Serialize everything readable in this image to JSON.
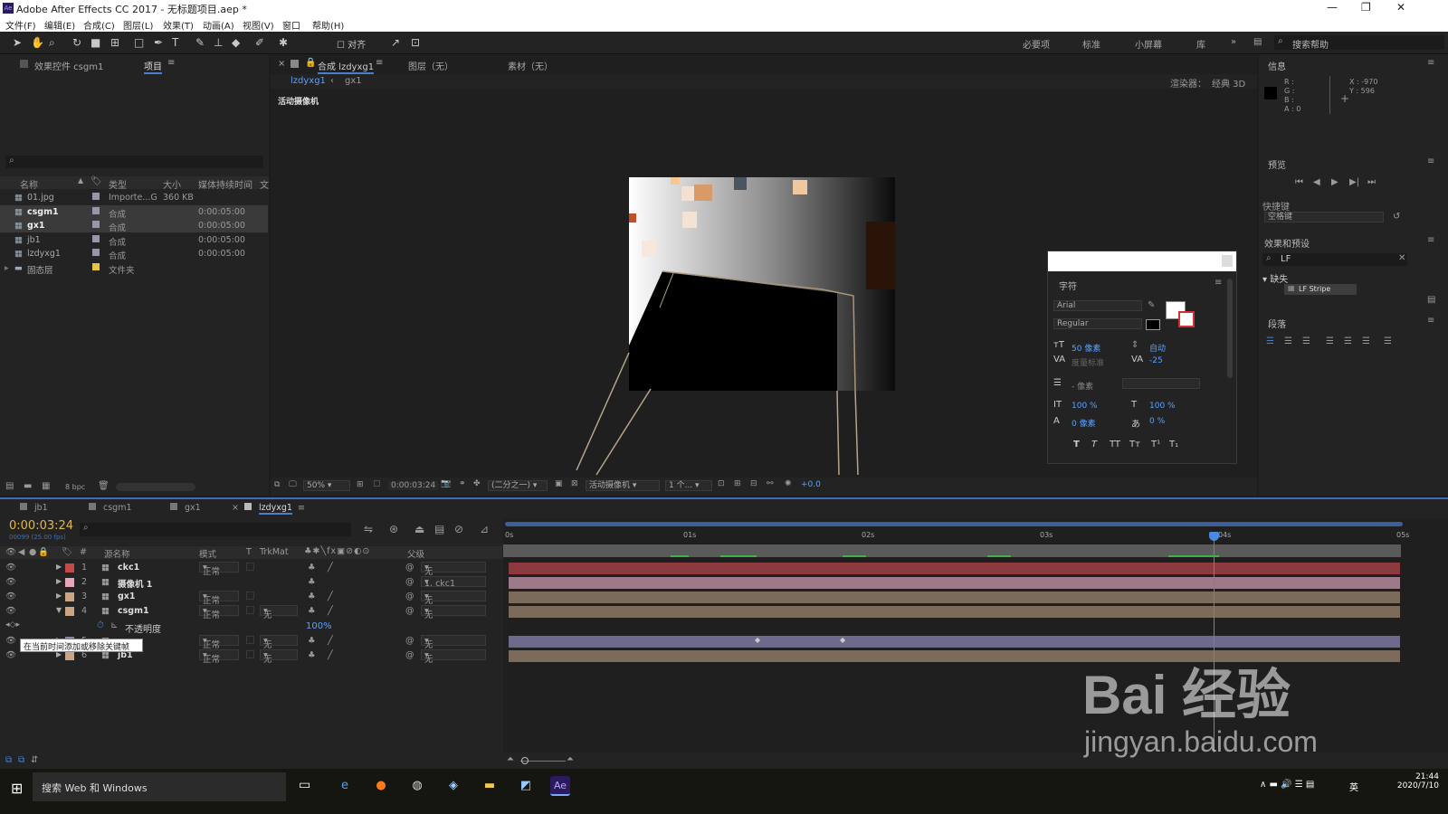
{
  "window": {
    "title": "Adobe After Effects CC 2017 - 无标题项目.aep *",
    "logo": "Ae"
  },
  "menu": [
    "文件(F)",
    "编辑(E)",
    "合成(C)",
    "图层(L)",
    "效果(T)",
    "动画(A)",
    "视图(V)",
    "窗口",
    "帮助(H)"
  ],
  "toolbar": {
    "snap_label": "对齐",
    "workspaces": [
      "必要项",
      "标准",
      "小屏幕",
      "库"
    ],
    "search_placeholder": "搜索帮助"
  },
  "project": {
    "tab_effects": "效果控件 csgm1",
    "tab_project": "项目",
    "search_icon": "⌕",
    "columns": [
      "名称",
      "类型",
      "大小",
      "媒体持续时间",
      "文"
    ],
    "items": [
      {
        "name": "01.jpg",
        "type": "Importe...G",
        "size": "360 KB",
        "dur": "",
        "color": "#9a95a8"
      },
      {
        "name": "csgm1",
        "type": "合成",
        "size": "",
        "dur": "0:00:05:00",
        "color": "#9a95a8"
      },
      {
        "name": "gx1",
        "type": "合成",
        "size": "",
        "dur": "0:00:05:00",
        "color": "#9a95a8"
      },
      {
        "name": "jb1",
        "type": "合成",
        "size": "",
        "dur": "0:00:05:00",
        "color": "#9a95a8"
      },
      {
        "name": "lzdyxg1",
        "type": "合成",
        "size": "",
        "dur": "0:00:05:00",
        "color": "#9a95a8"
      },
      {
        "name": "固态层",
        "type": "文件夹",
        "size": "",
        "dur": "",
        "color": "#e5c64a"
      }
    ],
    "bpc": "8 bpc"
  },
  "comp": {
    "tab_label": "合成 lzdyxg1",
    "tab_layer": "图层（无）",
    "tab_footage": "素材（无）",
    "breadcrumb": [
      "lzdyxg1",
      "gx1"
    ],
    "renderer": "渲染器：",
    "renderer_value": "经典 3D",
    "camera_label": "活动摄像机",
    "footer": {
      "zoom": "50%",
      "timecode": "0:00:03:24",
      "resolution": "(二分之一)",
      "camera": "活动摄像机",
      "views": "1 个...",
      "exposure": "+0.0"
    }
  },
  "character": {
    "title": "字符",
    "font": "Arial",
    "style": "Regular",
    "size": "50 像素",
    "leading": "自动",
    "kerning": "度量标准",
    "tracking": "-25",
    "stroke": "- 像素",
    "vscale": "100 %",
    "hscale": "100 %",
    "baseline": "0 像素",
    "tsume": "0 %",
    "styles": [
      "T",
      "T",
      "TT",
      "Tт",
      "T¹",
      "T₁"
    ]
  },
  "info": {
    "title": "信息",
    "r": "R :",
    "g": "G :",
    "b": "B :",
    "a": "A : 0",
    "x": "X : -970",
    "y": "Y : 596"
  },
  "preview": {
    "title": "预览",
    "shortcut_label": "快捷键",
    "shortcut_value": "空格键"
  },
  "effects": {
    "title": "效果和预设",
    "search_value": "LF",
    "category": "缺失",
    "item": "LF Stripe"
  },
  "paragraph": {
    "title": "段落"
  },
  "timeline": {
    "tabs": [
      "jb1",
      "csgm1",
      "gx1",
      "lzdyxg1"
    ],
    "timecode": "0:00:03:24",
    "timecode_sub": "00099 (25.00 fps)",
    "columns": [
      "#",
      "源名称",
      "模式",
      "T",
      "TrkMat",
      "父级"
    ],
    "ruler": [
      "0s",
      "01s",
      "02s",
      "03s",
      "04s",
      "05s"
    ],
    "layers": [
      {
        "num": "1",
        "name": "ckc1",
        "mode": "正常",
        "trk": "",
        "parent": "无",
        "color": "#c24a4a",
        "bar": "#8d3a3f"
      },
      {
        "num": "2",
        "name": "摄像机 1",
        "mode": "",
        "trk": "",
        "parent": "1. ckc1",
        "color": "#e7a7b8",
        "bar": "#9c7a89"
      },
      {
        "num": "3",
        "name": "gx1",
        "mode": "正常",
        "trk": "",
        "parent": "无",
        "color": "#c9a585",
        "bar": "#7c6a5a"
      },
      {
        "num": "4",
        "name": "csgm1",
        "mode": "正常",
        "trk": "无",
        "parent": "无",
        "color": "#c9a585",
        "bar": "#7c6a5a"
      },
      {
        "num": "5",
        "name": "",
        "mode": "正常",
        "trk": "无",
        "parent": "无",
        "color": "#8a86a6",
        "bar": "#6d6a8c"
      },
      {
        "num": "6",
        "name": "jb1",
        "mode": "正常",
        "trk": "无",
        "parent": "无",
        "color": "#c9a585",
        "bar": "#7c6a5a"
      }
    ],
    "opacity_label": "不透明度",
    "opacity_value": "100%",
    "tooltip": "在当前时间添加或移除关键帧"
  },
  "taskbar": {
    "search": "搜索 Web 和 Windows",
    "time": "21:44",
    "date": "2020/7/10",
    "ime": "英"
  },
  "watermark": {
    "text": "Bai  经验",
    "url": "jingyan.baidu.com"
  }
}
